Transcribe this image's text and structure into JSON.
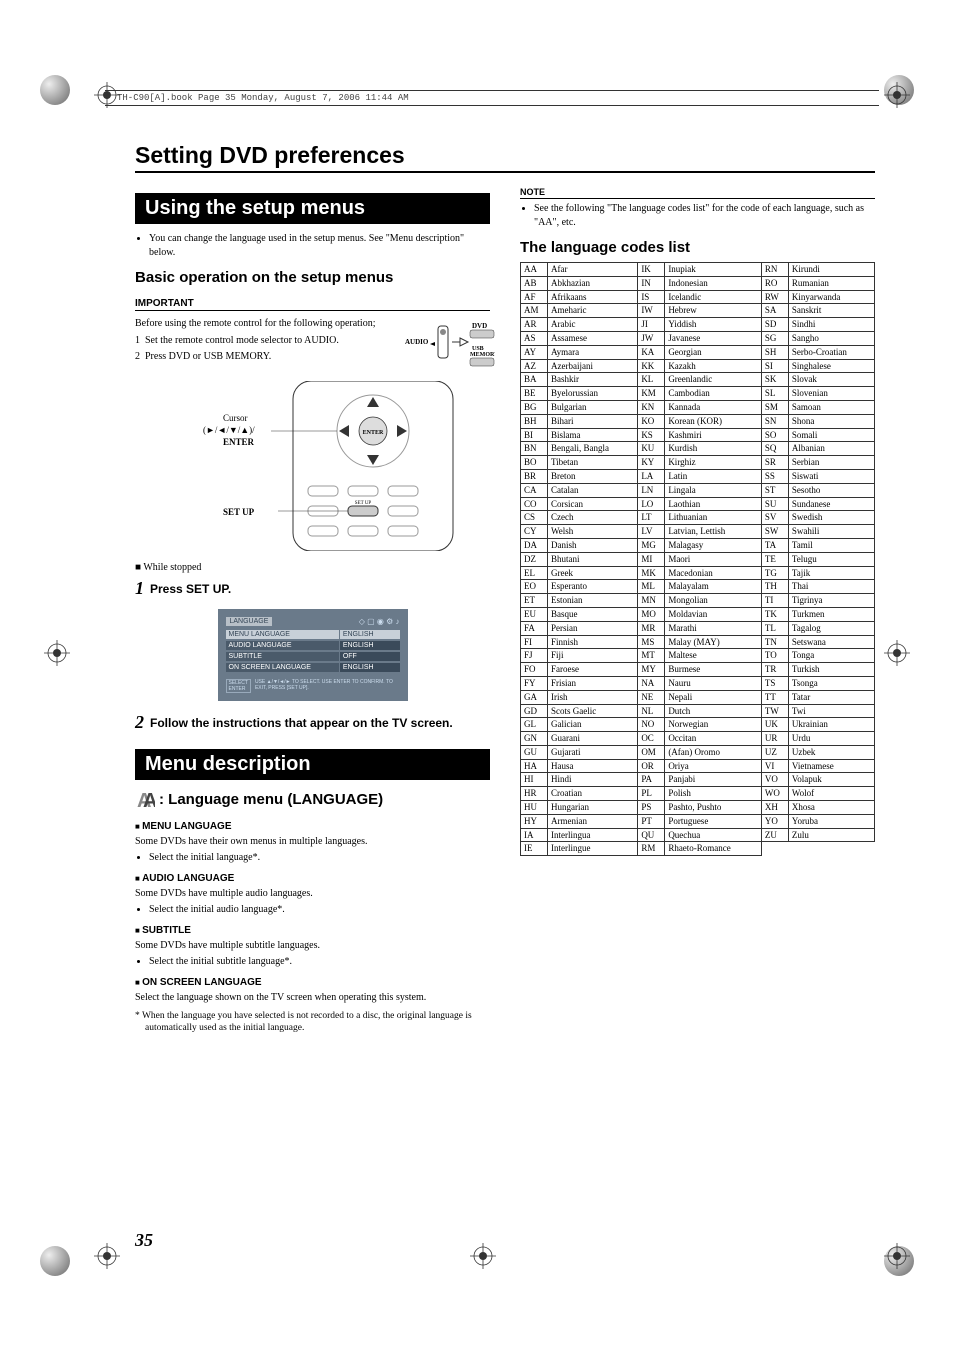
{
  "file_header": "TH-C90[A].book  Page 35  Monday, August 7, 2006  11:44 AM",
  "title": "Setting DVD preferences",
  "page_number": "35",
  "left": {
    "section1": "Using the setup menus",
    "p1": "You can change the language used in the setup menus. See \"Menu description\" below.",
    "sub1": "Basic operation on the setup menus",
    "important": "IMPORTANT",
    "imp_text": "Before using the remote control for the following operation;",
    "imp_1": "Set the remote control mode selector to AUDIO.",
    "imp_2": "Press DVD or USB MEMORY.",
    "audio_label": "AUDIO",
    "dvd_label": "DVD",
    "usb_label": "USB MEMORY",
    "cursor_label": "Cursor",
    "cursor_sub": "(►/◄/▼/▲)/",
    "enter_label": "ENTER",
    "setup_btn_label": "SET UP",
    "setup_remote_label": "SET UP",
    "while_stopped": "While stopped",
    "step1_n": "1",
    "step1_t": "Press SET UP.",
    "screenshot": {
      "tab": "LANGUAGE",
      "rows": [
        {
          "l": "MENU LANGUAGE",
          "r": "ENGLISH",
          "sel": true
        },
        {
          "l": "AUDIO LANGUAGE",
          "r": "ENGLISH"
        },
        {
          "l": "SUBTITLE",
          "r": "OFF"
        },
        {
          "l": "ON SCREEN LANGUAGE",
          "r": "ENGLISH"
        }
      ],
      "hint_l": "SELECT",
      "hint_r": "USE ▲/▼/◄/► TO SELECT. USE ENTER TO CONFIRM. TO EXIT, PRESS [SET UP]."
    },
    "step2_n": "2",
    "step2_t": "Follow the instructions that appear on the TV screen.",
    "section2": "Menu description",
    "lang_menu": ": Language menu (LANGUAGE)",
    "blocks": [
      {
        "hd": "MENU LANGUAGE",
        "p": "Some DVDs have their own menus in multiple languages.",
        "b": "Select the initial language*."
      },
      {
        "hd": "AUDIO LANGUAGE",
        "p": "Some DVDs have multiple audio languages.",
        "b": "Select the initial audio language*."
      },
      {
        "hd": "SUBTITLE",
        "p": "Some DVDs have multiple subtitle languages.",
        "b": "Select the initial subtitle language*."
      },
      {
        "hd": "ON SCREEN LANGUAGE",
        "p": "Select the language shown on the TV screen when operating this system.",
        "b": ""
      }
    ],
    "footnote": "* When the language you have selected is not recorded to a disc, the original language is automatically used as the initial language."
  },
  "right": {
    "note": "NOTE",
    "note_text": "See the following \"The language codes list\" for the code of each language, such as \"AA\", etc.",
    "sub1": "The language codes list",
    "codes": [
      [
        "AA",
        "Afar",
        "IK",
        "Inupiak",
        "RN",
        "Kirundi"
      ],
      [
        "AB",
        "Abkhazian",
        "IN",
        "Indonesian",
        "RO",
        "Rumanian"
      ],
      [
        "AF",
        "Afrikaans",
        "IS",
        "Icelandic",
        "RW",
        "Kinyarwanda"
      ],
      [
        "AM",
        "Ameharic",
        "IW",
        "Hebrew",
        "SA",
        "Sanskrit"
      ],
      [
        "AR",
        "Arabic",
        "JI",
        "Yiddish",
        "SD",
        "Sindhi"
      ],
      [
        "AS",
        "Assamese",
        "JW",
        "Javanese",
        "SG",
        "Sangho"
      ],
      [
        "AY",
        "Aymara",
        "KA",
        "Georgian",
        "SH",
        "Serbo-Croatian"
      ],
      [
        "AZ",
        "Azerbaijani",
        "KK",
        "Kazakh",
        "SI",
        "Singhalese"
      ],
      [
        "BA",
        "Bashkir",
        "KL",
        "Greenlandic",
        "SK",
        "Slovak"
      ],
      [
        "BE",
        "Byelorussian",
        "KM",
        "Cambodian",
        "SL",
        "Slovenian"
      ],
      [
        "BG",
        "Bulgarian",
        "KN",
        "Kannada",
        "SM",
        "Samoan"
      ],
      [
        "BH",
        "Bihari",
        "KO",
        "Korean (KOR)",
        "SN",
        "Shona"
      ],
      [
        "BI",
        "Bislama",
        "KS",
        "Kashmiri",
        "SO",
        "Somali"
      ],
      [
        "BN",
        "Bengali, Bangla",
        "KU",
        "Kurdish",
        "SQ",
        "Albanian"
      ],
      [
        "BO",
        "Tibetan",
        "KY",
        "Kirghiz",
        "SR",
        "Serbian"
      ],
      [
        "BR",
        "Breton",
        "LA",
        "Latin",
        "SS",
        "Siswati"
      ],
      [
        "CA",
        "Catalan",
        "LN",
        "Lingala",
        "ST",
        "Sesotho"
      ],
      [
        "CO",
        "Corsican",
        "LO",
        "Laothian",
        "SU",
        "Sundanese"
      ],
      [
        "CS",
        "Czech",
        "LT",
        "Lithuanian",
        "SV",
        "Swedish"
      ],
      [
        "CY",
        "Welsh",
        "LV",
        "Latvian, Lettish",
        "SW",
        "Swahili"
      ],
      [
        "DA",
        "Danish",
        "MG",
        "Malagasy",
        "TA",
        "Tamil"
      ],
      [
        "DZ",
        "Bhutani",
        "MI",
        "Maori",
        "TE",
        "Telugu"
      ],
      [
        "EL",
        "Greek",
        "MK",
        "Macedonian",
        "TG",
        "Tajik"
      ],
      [
        "EO",
        "Esperanto",
        "ML",
        "Malayalam",
        "TH",
        "Thai"
      ],
      [
        "ET",
        "Estonian",
        "MN",
        "Mongolian",
        "TI",
        "Tigrinya"
      ],
      [
        "EU",
        "Basque",
        "MO",
        "Moldavian",
        "TK",
        "Turkmen"
      ],
      [
        "FA",
        "Persian",
        "MR",
        "Marathi",
        "TL",
        "Tagalog"
      ],
      [
        "FI",
        "Finnish",
        "MS",
        "Malay (MAY)",
        "TN",
        "Setswana"
      ],
      [
        "FJ",
        "Fiji",
        "MT",
        "Maltese",
        "TO",
        "Tonga"
      ],
      [
        "FO",
        "Faroese",
        "MY",
        "Burmese",
        "TR",
        "Turkish"
      ],
      [
        "FY",
        "Frisian",
        "NA",
        "Nauru",
        "TS",
        "Tsonga"
      ],
      [
        "GA",
        "Irish",
        "NE",
        "Nepali",
        "TT",
        "Tatar"
      ],
      [
        "GD",
        "Scots Gaelic",
        "NL",
        "Dutch",
        "TW",
        "Twi"
      ],
      [
        "GL",
        "Galician",
        "NO",
        "Norwegian",
        "UK",
        "Ukrainian"
      ],
      [
        "GN",
        "Guarani",
        "OC",
        "Occitan",
        "UR",
        "Urdu"
      ],
      [
        "GU",
        "Gujarati",
        "OM",
        "(Afan) Oromo",
        "UZ",
        "Uzbek"
      ],
      [
        "HA",
        "Hausa",
        "OR",
        "Oriya",
        "VI",
        "Vietnamese"
      ],
      [
        "HI",
        "Hindi",
        "PA",
        "Panjabi",
        "VO",
        "Volapuk"
      ],
      [
        "HR",
        "Croatian",
        "PL",
        "Polish",
        "WO",
        "Wolof"
      ],
      [
        "HU",
        "Hungarian",
        "PS",
        "Pashto, Pushto",
        "XH",
        "Xhosa"
      ],
      [
        "HY",
        "Armenian",
        "PT",
        "Portuguese",
        "YO",
        "Yoruba"
      ],
      [
        "IA",
        "Interlingua",
        "QU",
        "Quechua",
        "ZU",
        "Zulu"
      ],
      [
        "IE",
        "Interlingue",
        "RM",
        "Rhaeto-Romance",
        "",
        ""
      ]
    ]
  }
}
